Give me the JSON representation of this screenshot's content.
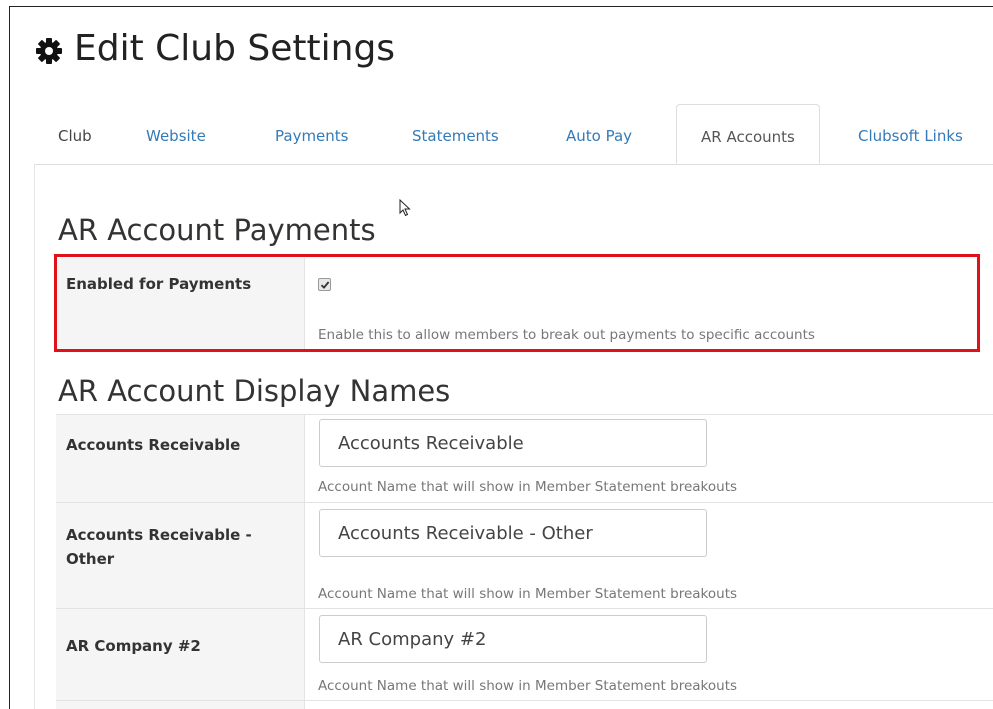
{
  "page": {
    "title": "Edit Club Settings",
    "title_icon": "gear-icon"
  },
  "tabs": [
    {
      "label": "Club",
      "active": false
    },
    {
      "label": "Website",
      "active": false
    },
    {
      "label": "Payments",
      "active": false
    },
    {
      "label": "Statements",
      "active": false
    },
    {
      "label": "Auto Pay",
      "active": false
    },
    {
      "label": "AR Accounts",
      "active": true
    },
    {
      "label": "Clubsoft Links",
      "active": false
    }
  ],
  "payments_section": {
    "heading": "AR Account Payments",
    "enabled_label": "Enabled for Payments",
    "enabled_checked": true,
    "enabled_help": "Enable this to allow members to break out payments to specific accounts"
  },
  "display_names_section": {
    "heading": "AR Account Display Names",
    "rows": [
      {
        "label": "Accounts Receivable",
        "value": "Accounts Receivable",
        "help": "Account Name that will show in Member Statement breakouts"
      },
      {
        "label": "Accounts Receivable - Other",
        "value": "Accounts Receivable - Other",
        "help": "Account Name that will show in Member Statement breakouts"
      },
      {
        "label": "AR Company #2",
        "value": "AR Company #2",
        "help": "Account Name that will show in Member Statement breakouts"
      }
    ]
  },
  "colors": {
    "link": "#337ab7",
    "highlight_border": "#e0111b",
    "label_bg": "#f5f5f5"
  }
}
